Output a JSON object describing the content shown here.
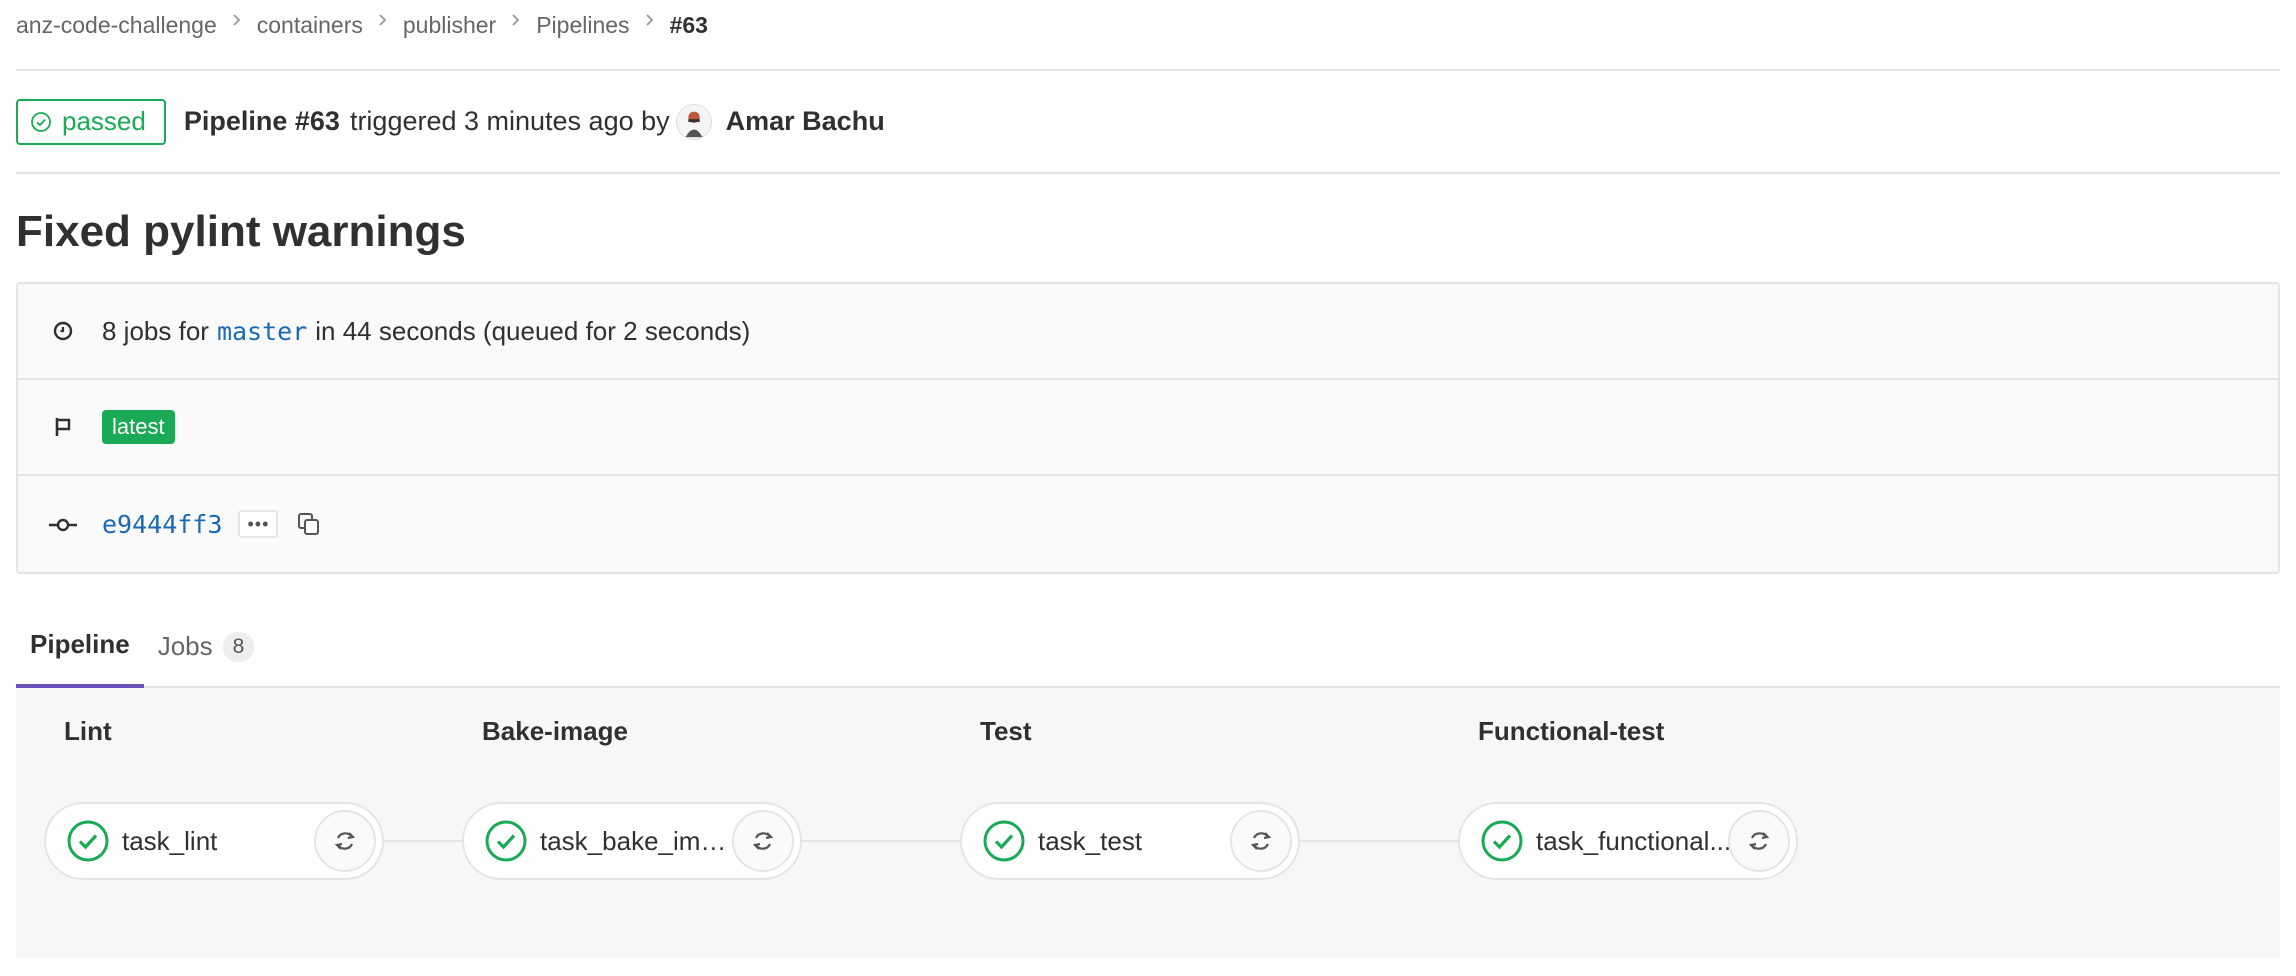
{
  "breadcrumb": [
    "anz-code-challenge",
    "containers",
    "publisher",
    "Pipelines",
    "#63"
  ],
  "header": {
    "status": "passed",
    "pipeline_label": "Pipeline #63",
    "triggered_text": "triggered 3 minutes ago by",
    "author": "Amar Bachu"
  },
  "title": "Fixed pylint warnings",
  "info": {
    "jobs_prefix": "8 jobs for",
    "branch": "master",
    "jobs_suffix": "in 44 seconds (queued for 2 seconds)",
    "tag": "latest",
    "sha": "e9444ff3",
    "ellipsis": "•••"
  },
  "tabs": [
    {
      "label": "Pipeline",
      "active": true
    },
    {
      "label": "Jobs",
      "count": "8",
      "active": false
    }
  ],
  "stages": [
    {
      "name": "Lint",
      "job": "task_lint"
    },
    {
      "name": "Bake-image",
      "job": "task_bake_image"
    },
    {
      "name": "Test",
      "job": "task_test"
    },
    {
      "name": "Functional-test",
      "job": "task_functional..."
    }
  ],
  "colors": {
    "success": "#1aaa55",
    "link": "#1b69b6",
    "active_tab": "#6b4fbb"
  },
  "icons": {
    "status": "check-circle-icon",
    "duration": "clock-icon",
    "tag": "flag-icon",
    "commit": "commit-icon",
    "copy": "copy-icon",
    "retry": "retry-icon"
  }
}
